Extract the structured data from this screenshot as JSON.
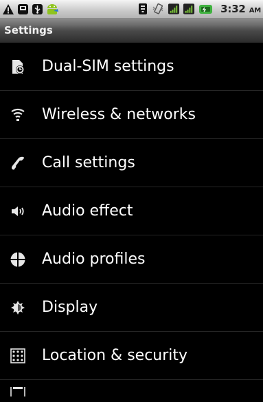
{
  "status_bar": {
    "time": "3:32",
    "ampm": "AM",
    "icons": [
      "warning-icon",
      "sd-card-icon",
      "usb-icon",
      "android-icon",
      "wifi-icon",
      "vibrate-icon",
      "signal-sim1-icon",
      "signal-sim2-icon",
      "battery-icon"
    ]
  },
  "title_bar": {
    "title": "Settings"
  },
  "settings": {
    "items": [
      {
        "label": "Dual-SIM settings",
        "icon": "dual-sim-icon"
      },
      {
        "label": "Wireless & networks",
        "icon": "wireless-icon"
      },
      {
        "label": "Call settings",
        "icon": "phone-handset-icon"
      },
      {
        "label": "Audio effect",
        "icon": "speaker-icon"
      },
      {
        "label": "Audio profiles",
        "icon": "audio-profiles-icon"
      },
      {
        "label": "Display",
        "icon": "display-icon"
      },
      {
        "label": "Location & security",
        "icon": "location-grid-icon"
      }
    ]
  },
  "colors": {
    "background": "#000000",
    "text": "#ffffff",
    "status_bar": "#cfcfcf",
    "battery_green": "#3fb23f"
  }
}
